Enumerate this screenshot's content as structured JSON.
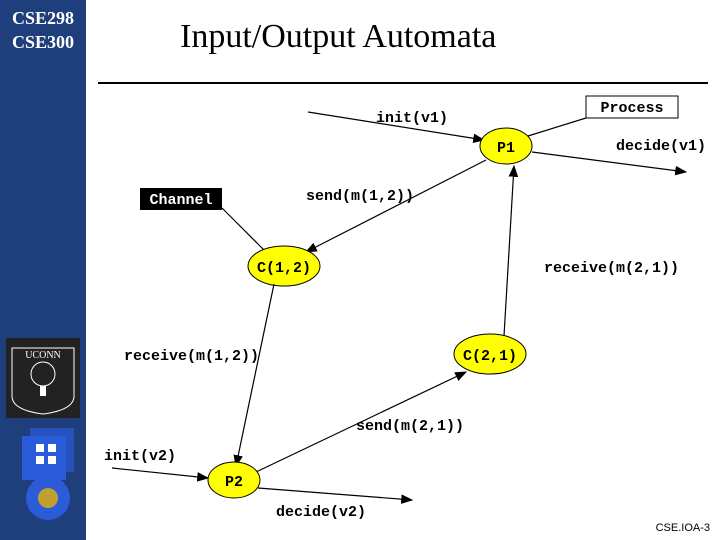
{
  "sidebar": {
    "course_top": "CSE298",
    "course_bottom": "CSE300",
    "uconn": "UCONN"
  },
  "title": "Input/Output Automata",
  "labels": {
    "process": "Process",
    "channel": "Channel"
  },
  "diagram": {
    "init_v1": "init(v1)",
    "p1": "P1",
    "decide_v1": "decide(v1)",
    "send_m12": "send(m(1,2))",
    "c12": "C(1,2)",
    "receive_m21": "receive(m(2,1))",
    "receive_m12": "receive(m(1,2))",
    "c21": "C(2,1)",
    "send_m21": "send(m(2,1))",
    "init_v2": "init(v2)",
    "p2": "P2",
    "decide_v2": "decide(v2)"
  },
  "footer": "CSE.IOA-3"
}
